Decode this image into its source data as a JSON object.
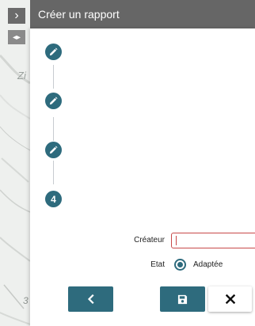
{
  "header": {
    "title": "Créer un rapport"
  },
  "map": {
    "label_fragment": "Zi",
    "bottom_label": "3"
  },
  "steps": [
    {
      "type": "completed",
      "icon": "pencil-icon"
    },
    {
      "type": "completed",
      "icon": "pencil-icon"
    },
    {
      "type": "completed",
      "icon": "pencil-icon"
    },
    {
      "type": "current",
      "number": "4"
    }
  ],
  "form": {
    "creator_label": "Créateur",
    "creator_value": "",
    "state_label": "Etat",
    "state_option": "Adaptée",
    "state_selected": true
  },
  "buttons": {
    "back": {
      "icon": "chevron-left-icon"
    },
    "save": {
      "icon": "save-icon"
    },
    "close": {
      "icon": "close-icon"
    }
  },
  "colors": {
    "accent": "#2e6b7d",
    "header": "#666666",
    "error_border": "#c74848"
  }
}
